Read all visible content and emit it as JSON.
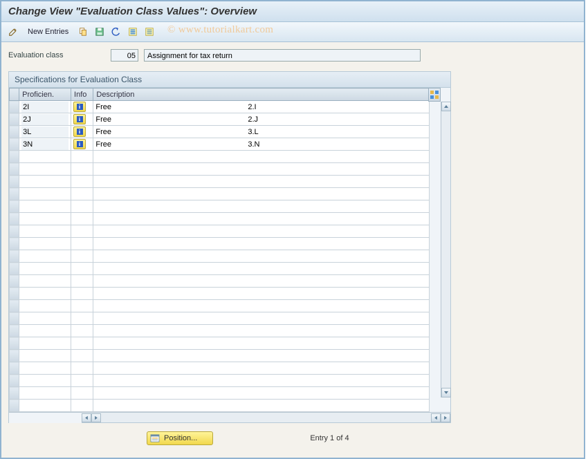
{
  "title": "Change View \"Evaluation Class Values\": Overview",
  "toolbar": {
    "new_entries": "New Entries"
  },
  "watermark": "© www.tutorialkart.com",
  "field": {
    "label": "Evaluation class",
    "code": "05",
    "text": "Assignment for tax return"
  },
  "panel": {
    "title": "Specifications for Evaluation Class",
    "columns": {
      "proficien": "Proficien.",
      "info": "Info",
      "description": "Description"
    },
    "rows": [
      {
        "prof": "2I",
        "free": "Free",
        "val": "2.I"
      },
      {
        "prof": "2J",
        "free": "Free",
        "val": "2.J"
      },
      {
        "prof": "3L",
        "free": "Free",
        "val": "3.L"
      },
      {
        "prof": "3N",
        "free": "Free",
        "val": "3.N"
      }
    ]
  },
  "footer": {
    "position": "Position...",
    "entry": "Entry 1 of 4"
  },
  "blank_row_count": 21
}
